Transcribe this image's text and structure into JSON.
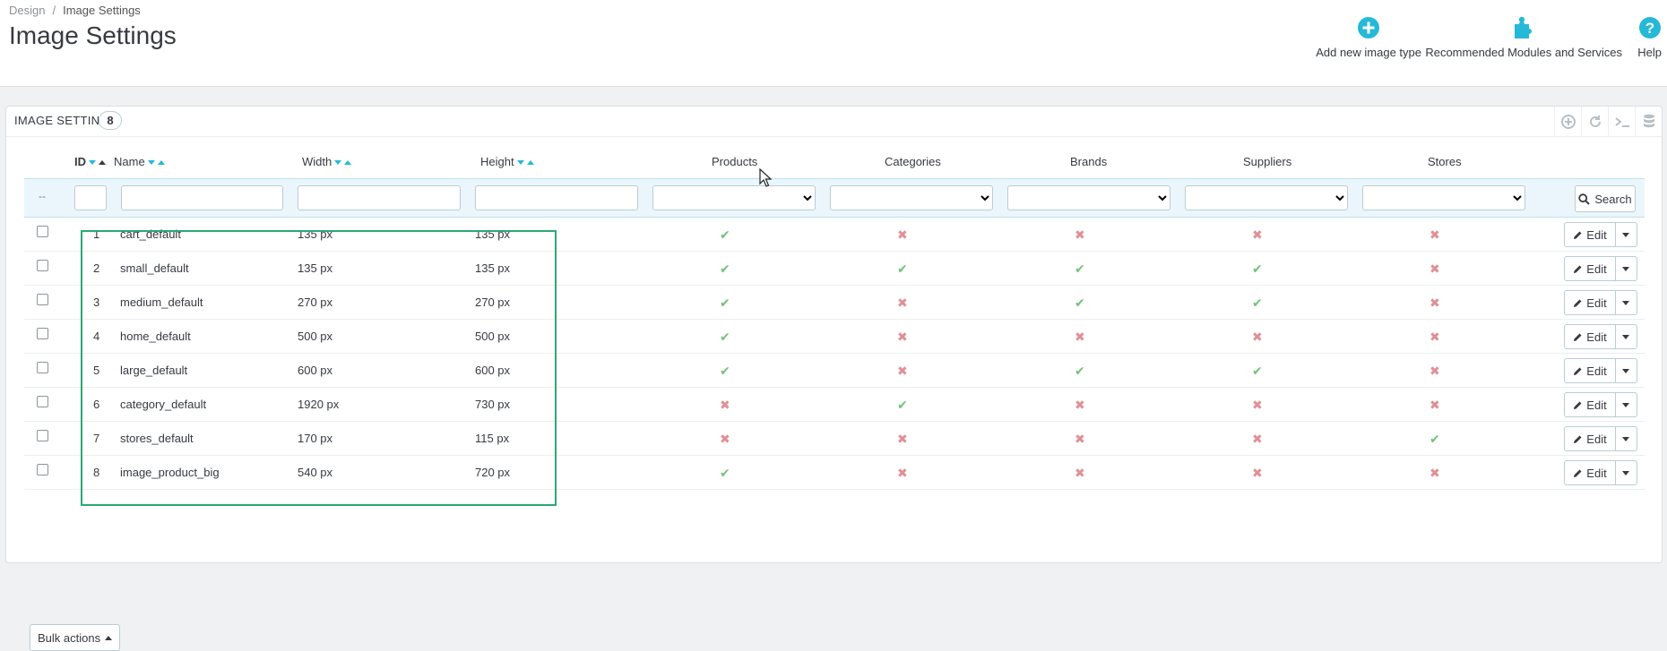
{
  "breadcrumb": {
    "parent": "Design",
    "separator": "/",
    "current": "Image Settings"
  },
  "page_title": "Image Settings",
  "toolbar": {
    "add_label": "Add new image type",
    "recommended_label": "Recommended Modules and Services",
    "help_label": "Help"
  },
  "panel": {
    "title": "IMAGE SETTINGS",
    "count": "8"
  },
  "columns": {
    "id": "ID",
    "name": "Name",
    "width": "Width",
    "height": "Height",
    "products": "Products",
    "categories": "Categories",
    "brands": "Brands",
    "suppliers": "Suppliers",
    "stores": "Stores"
  },
  "filter": {
    "dash": "--",
    "search_label": "Search"
  },
  "rows": [
    {
      "id": "1",
      "name": "cart_default",
      "width": "135 px",
      "height": "135 px",
      "products": true,
      "categories": false,
      "brands": false,
      "suppliers": false,
      "stores": false
    },
    {
      "id": "2",
      "name": "small_default",
      "width": "135 px",
      "height": "135 px",
      "products": true,
      "categories": true,
      "brands": true,
      "suppliers": true,
      "stores": false
    },
    {
      "id": "3",
      "name": "medium_default",
      "width": "270 px",
      "height": "270 px",
      "products": true,
      "categories": false,
      "brands": true,
      "suppliers": true,
      "stores": false
    },
    {
      "id": "4",
      "name": "home_default",
      "width": "500 px",
      "height": "500 px",
      "products": true,
      "categories": false,
      "brands": false,
      "suppliers": false,
      "stores": false
    },
    {
      "id": "5",
      "name": "large_default",
      "width": "600 px",
      "height": "600 px",
      "products": true,
      "categories": false,
      "brands": true,
      "suppliers": true,
      "stores": false
    },
    {
      "id": "6",
      "name": "category_default",
      "width": "1920 px",
      "height": "730 px",
      "products": false,
      "categories": true,
      "brands": false,
      "suppliers": false,
      "stores": false
    },
    {
      "id": "7",
      "name": "stores_default",
      "width": "170 px",
      "height": "115 px",
      "products": false,
      "categories": false,
      "brands": false,
      "suppliers": false,
      "stores": true
    },
    {
      "id": "8",
      "name": "image_product_big",
      "width": "540 px",
      "height": "720 px",
      "products": true,
      "categories": false,
      "brands": false,
      "suppliers": false,
      "stores": false
    }
  ],
  "row_action": {
    "edit_label": "Edit"
  },
  "bulk_label": "Bulk actions",
  "colors": {
    "accent": "#25b9d7",
    "yes": "#72c279",
    "no": "#e08f95",
    "highlight": "#2aa876"
  }
}
